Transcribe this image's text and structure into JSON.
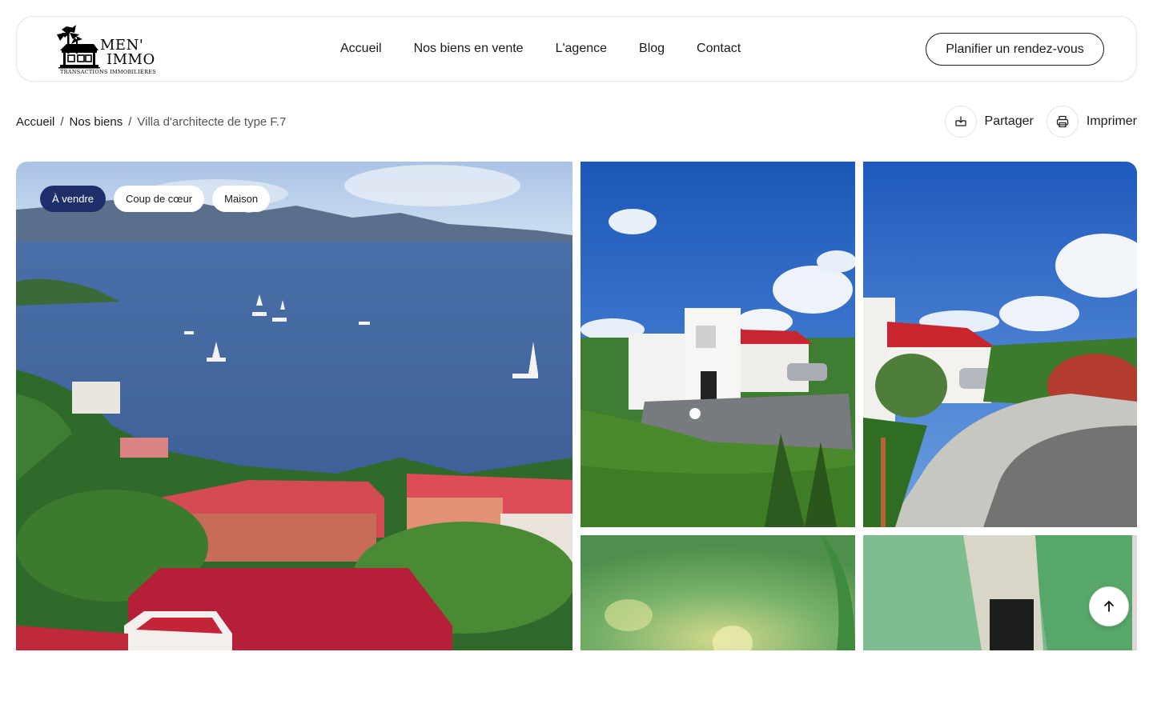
{
  "header": {
    "logo": {
      "line1": "MEN'",
      "line2": "IMMO",
      "tagline": "TRANSACTIONS IMMOBILIÈRES",
      "icon": "palm-house-logo"
    },
    "nav": [
      {
        "label": "Accueil"
      },
      {
        "label": "Nos biens en vente"
      },
      {
        "label": "L'agence"
      },
      {
        "label": "Blog"
      },
      {
        "label": "Contact"
      }
    ],
    "cta_label": "Planifier un rendez-vous"
  },
  "breadcrumb": {
    "items": [
      "Accueil",
      "Nos biens",
      "Villa d'architecte de type F.7"
    ],
    "separator": "/"
  },
  "actions": {
    "share": {
      "label": "Partager",
      "icon": "share-icon"
    },
    "print": {
      "label": "Imprimer",
      "icon": "printer-icon"
    }
  },
  "gallery": {
    "badges": [
      "À vendre",
      "Coup de cœur",
      "Maison"
    ],
    "photos": [
      {
        "name": "sea-view-photo"
      },
      {
        "name": "villa-front-photo"
      },
      {
        "name": "driveway-photo"
      },
      {
        "name": "green-ceiling-photo"
      },
      {
        "name": "green-hallway-photo"
      }
    ]
  },
  "colors": {
    "badge_dark": "#1f2f6b",
    "text": "#1a1a1a",
    "border": "#e6e6e6"
  },
  "scroll_top_icon": "arrow-up-icon"
}
